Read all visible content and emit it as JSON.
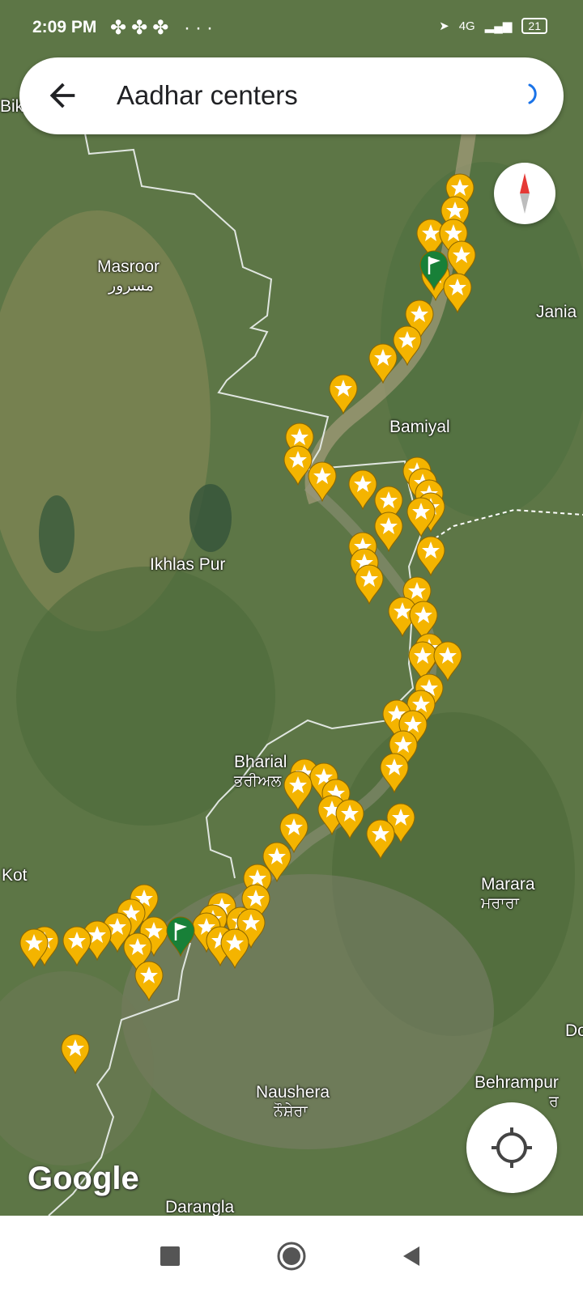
{
  "status_bar": {
    "time": "2:09 PM",
    "left_icons": [
      "app-icon",
      "app-icon",
      "app-icon"
    ],
    "more": "···",
    "network": "4G",
    "battery": "21"
  },
  "search": {
    "query": "Aadhar centers",
    "back_icon": "arrow-left-icon",
    "loading_icon": "loading-spinner-icon"
  },
  "map": {
    "places": [
      {
        "name": "Bik",
        "sub": ""
      },
      {
        "name": "Masroor",
        "sub": "مسرور"
      },
      {
        "name": "Jania",
        "sub": ""
      },
      {
        "name": "Bamiyal",
        "sub": ""
      },
      {
        "name": "Ikhlas Pur",
        "sub": ""
      },
      {
        "name": "Bharial",
        "sub": "ਭਰੀਅਲ"
      },
      {
        "name": "Kot",
        "sub": ""
      },
      {
        "name": "Marara",
        "sub": "ਮਰਾਰਾ"
      },
      {
        "name": "Do",
        "sub": ""
      },
      {
        "name": "Naushera",
        "sub": "ਨੌਸ਼ੇਰਾ"
      },
      {
        "name": "Behrampur",
        "sub": "ਰ"
      },
      {
        "name": "Darangla",
        "sub": ""
      }
    ],
    "marker_color": "#f4b400",
    "selected_marker_color": "#188038",
    "attribution": "Google"
  },
  "controls": {
    "compass_icon": "compass-icon",
    "locate_icon": "my-location-icon"
  },
  "nav_bar": {
    "recent_icon": "square-icon",
    "home_icon": "circle-icon",
    "back_icon": "triangle-back-icon"
  }
}
